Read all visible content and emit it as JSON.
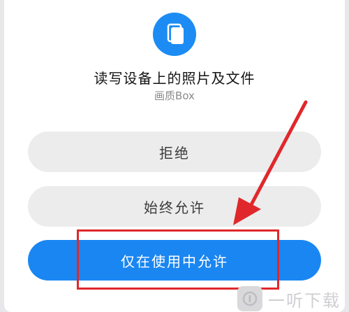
{
  "dialog": {
    "title": "读写设备上的照片及文件",
    "app_name": "画质Box",
    "icon": "files-icon",
    "buttons": {
      "deny": "拒绝",
      "always_allow": "始终允许",
      "allow_while_using": "仅在使用中允许"
    }
  },
  "annotation": {
    "color": "#e0282c"
  },
  "watermark": {
    "text": "一听下载"
  },
  "colors": {
    "accent": "#1a86f2",
    "button_gray": "#ececed"
  }
}
